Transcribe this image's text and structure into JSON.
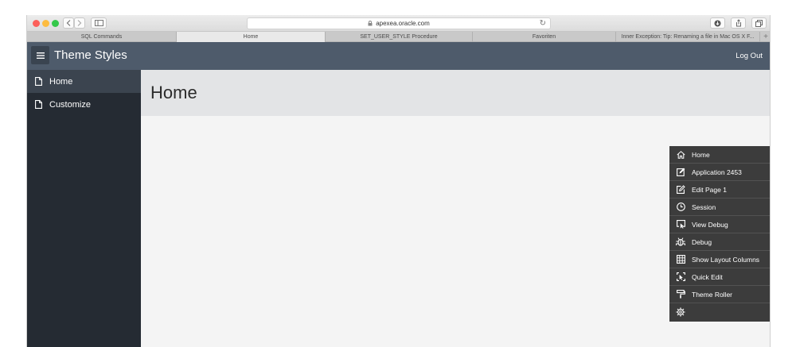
{
  "browser": {
    "address": "apexea.oracle.com",
    "tabs": [
      {
        "label": "SQL Commands",
        "active": false
      },
      {
        "label": "Home",
        "active": true
      },
      {
        "label": "SET_USER_STYLE Procedure",
        "active": false
      },
      {
        "label": "Favoriten",
        "active": false
      },
      {
        "label": "Inner Exception: Tip: Renaming a file in Mac OS X F...",
        "active": false
      }
    ],
    "new_tab": "+"
  },
  "header": {
    "title": "Theme Styles",
    "logout": "Log Out"
  },
  "sidebar": {
    "items": [
      {
        "label": "Home",
        "icon": "file-icon",
        "active": true
      },
      {
        "label": "Customize",
        "icon": "file-icon",
        "active": false
      }
    ]
  },
  "page": {
    "title": "Home"
  },
  "devbar": {
    "items": [
      {
        "label": "Home",
        "icon": "home-icon"
      },
      {
        "label": "Application 2453",
        "icon": "edit-square-icon"
      },
      {
        "label": "Edit Page 1",
        "icon": "edit-pencil-icon"
      },
      {
        "label": "Session",
        "icon": "clock-icon"
      },
      {
        "label": "View Debug",
        "icon": "view-debug-icon"
      },
      {
        "label": "Debug",
        "icon": "bug-icon"
      },
      {
        "label": "Show Layout Columns",
        "icon": "grid-icon"
      },
      {
        "label": "Quick Edit",
        "icon": "quick-edit-icon"
      },
      {
        "label": "Theme Roller",
        "icon": "paint-roller-icon"
      },
      {
        "label": "",
        "icon": "gear-icon"
      }
    ]
  },
  "colors": {
    "header_bg": "#4e5b6b",
    "sidebar_bg": "#252b33",
    "sidebar_active": "#3b444f",
    "page_header_bg": "#e3e4e6",
    "devbar_bg": "#3c3c3c"
  }
}
